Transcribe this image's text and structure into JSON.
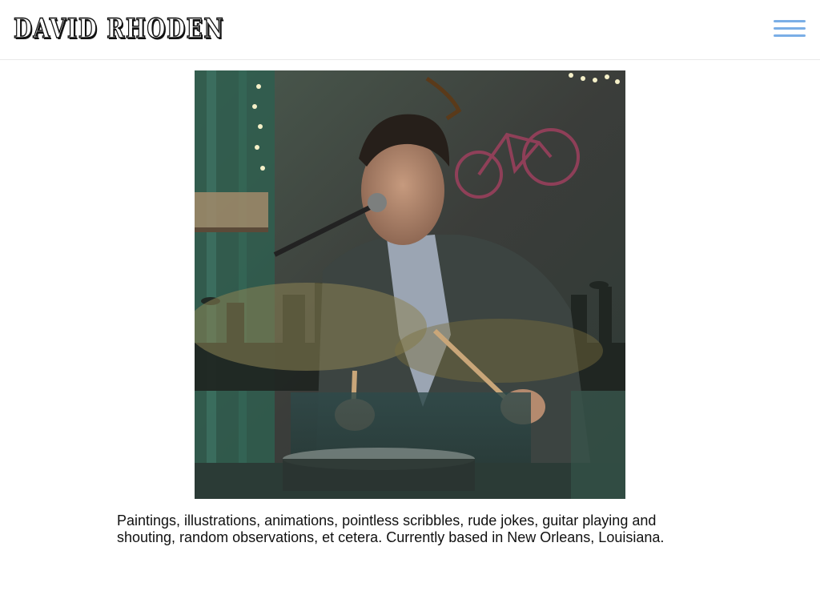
{
  "header": {
    "site_title": "DAVID RHODEN",
    "menu_icon": "hamburger-menu-icon",
    "menu_color": "#7aaee6"
  },
  "main": {
    "hero_image": "portrait-collage",
    "bio_text": "Paintings, illustrations, animations, pointless scribbles, rude jokes, guitar playing and shouting, random observations, et cetera. Currently based in New Orleans, Louisiana."
  }
}
